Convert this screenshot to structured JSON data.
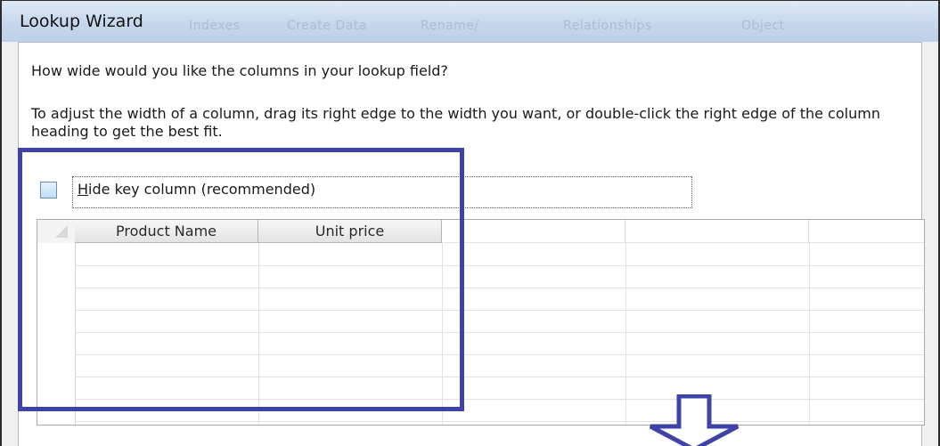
{
  "window": {
    "title": "Lookup Wizard",
    "ghost_tabs": [
      "Indexes",
      "Create Data",
      "Rename/",
      "Relationships",
      "Object"
    ]
  },
  "content": {
    "question": "How wide would you like the columns in your lookup field?",
    "instructions": "To adjust the width of a column, drag its right edge to the width you want, or double-click the right edge of the column heading to get the best fit.",
    "hide_key": {
      "label_accel": "H",
      "label_rest": "ide key column (recommended)",
      "checked": false
    }
  },
  "grid": {
    "columns": [
      "Product Name",
      "Unit price"
    ],
    "rows": [
      [
        "",
        ""
      ],
      [
        "",
        ""
      ],
      [
        "",
        ""
      ],
      [
        "",
        ""
      ],
      [
        "",
        ""
      ],
      [
        "",
        ""
      ],
      [
        "",
        ""
      ],
      [
        "",
        ""
      ]
    ]
  },
  "annotations": {
    "highlight_color": "#3d43a8",
    "arrow_icon": "down-arrow-icon"
  }
}
